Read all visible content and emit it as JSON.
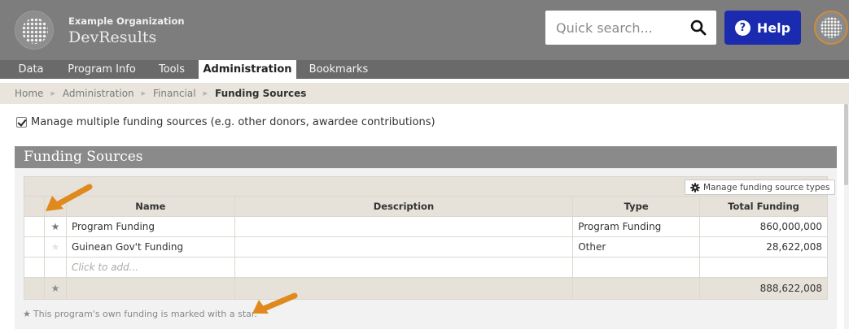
{
  "header": {
    "org_name": "Example Organization",
    "app_name": "DevResults",
    "search_placeholder": "Quick search...",
    "help_label": "Help"
  },
  "nav": {
    "items": [
      {
        "label": "Data"
      },
      {
        "label": "Program Info"
      },
      {
        "label": "Tools"
      },
      {
        "label": "Administration",
        "active": true
      },
      {
        "label": "Bookmarks"
      }
    ]
  },
  "breadcrumb": {
    "items": [
      "Home",
      "Administration",
      "Financial"
    ],
    "current": "Funding Sources"
  },
  "manage_multiple": {
    "checked": true,
    "label": "Manage multiple funding sources (e.g. other donors, awardee contributions)"
  },
  "panel": {
    "title": "Funding Sources",
    "manage_types_label": "Manage funding source types",
    "columns": {
      "name": "Name",
      "description": "Description",
      "type": "Type",
      "total": "Total Funding"
    },
    "rows": [
      {
        "starred": true,
        "name": "Program Funding",
        "description": "",
        "type": "Program Funding",
        "total": "860,000,000"
      },
      {
        "starred": false,
        "name": "Guinean Gov't Funding",
        "description": "",
        "type": "Other",
        "total": "28,622,008"
      }
    ],
    "add_placeholder": "Click to add...",
    "total_value": "888,622,008",
    "footnote": "This program's own funding is marked with a star."
  },
  "colors": {
    "header_bg": "#7d7d7d",
    "nav_bg": "#6a6a6a",
    "help_button": "#1a2bb0",
    "breadcrumb_bg": "#e9e4dc",
    "panel_header_bg": "#8a8a8a",
    "annotation_arrow": "#e08a1e"
  }
}
